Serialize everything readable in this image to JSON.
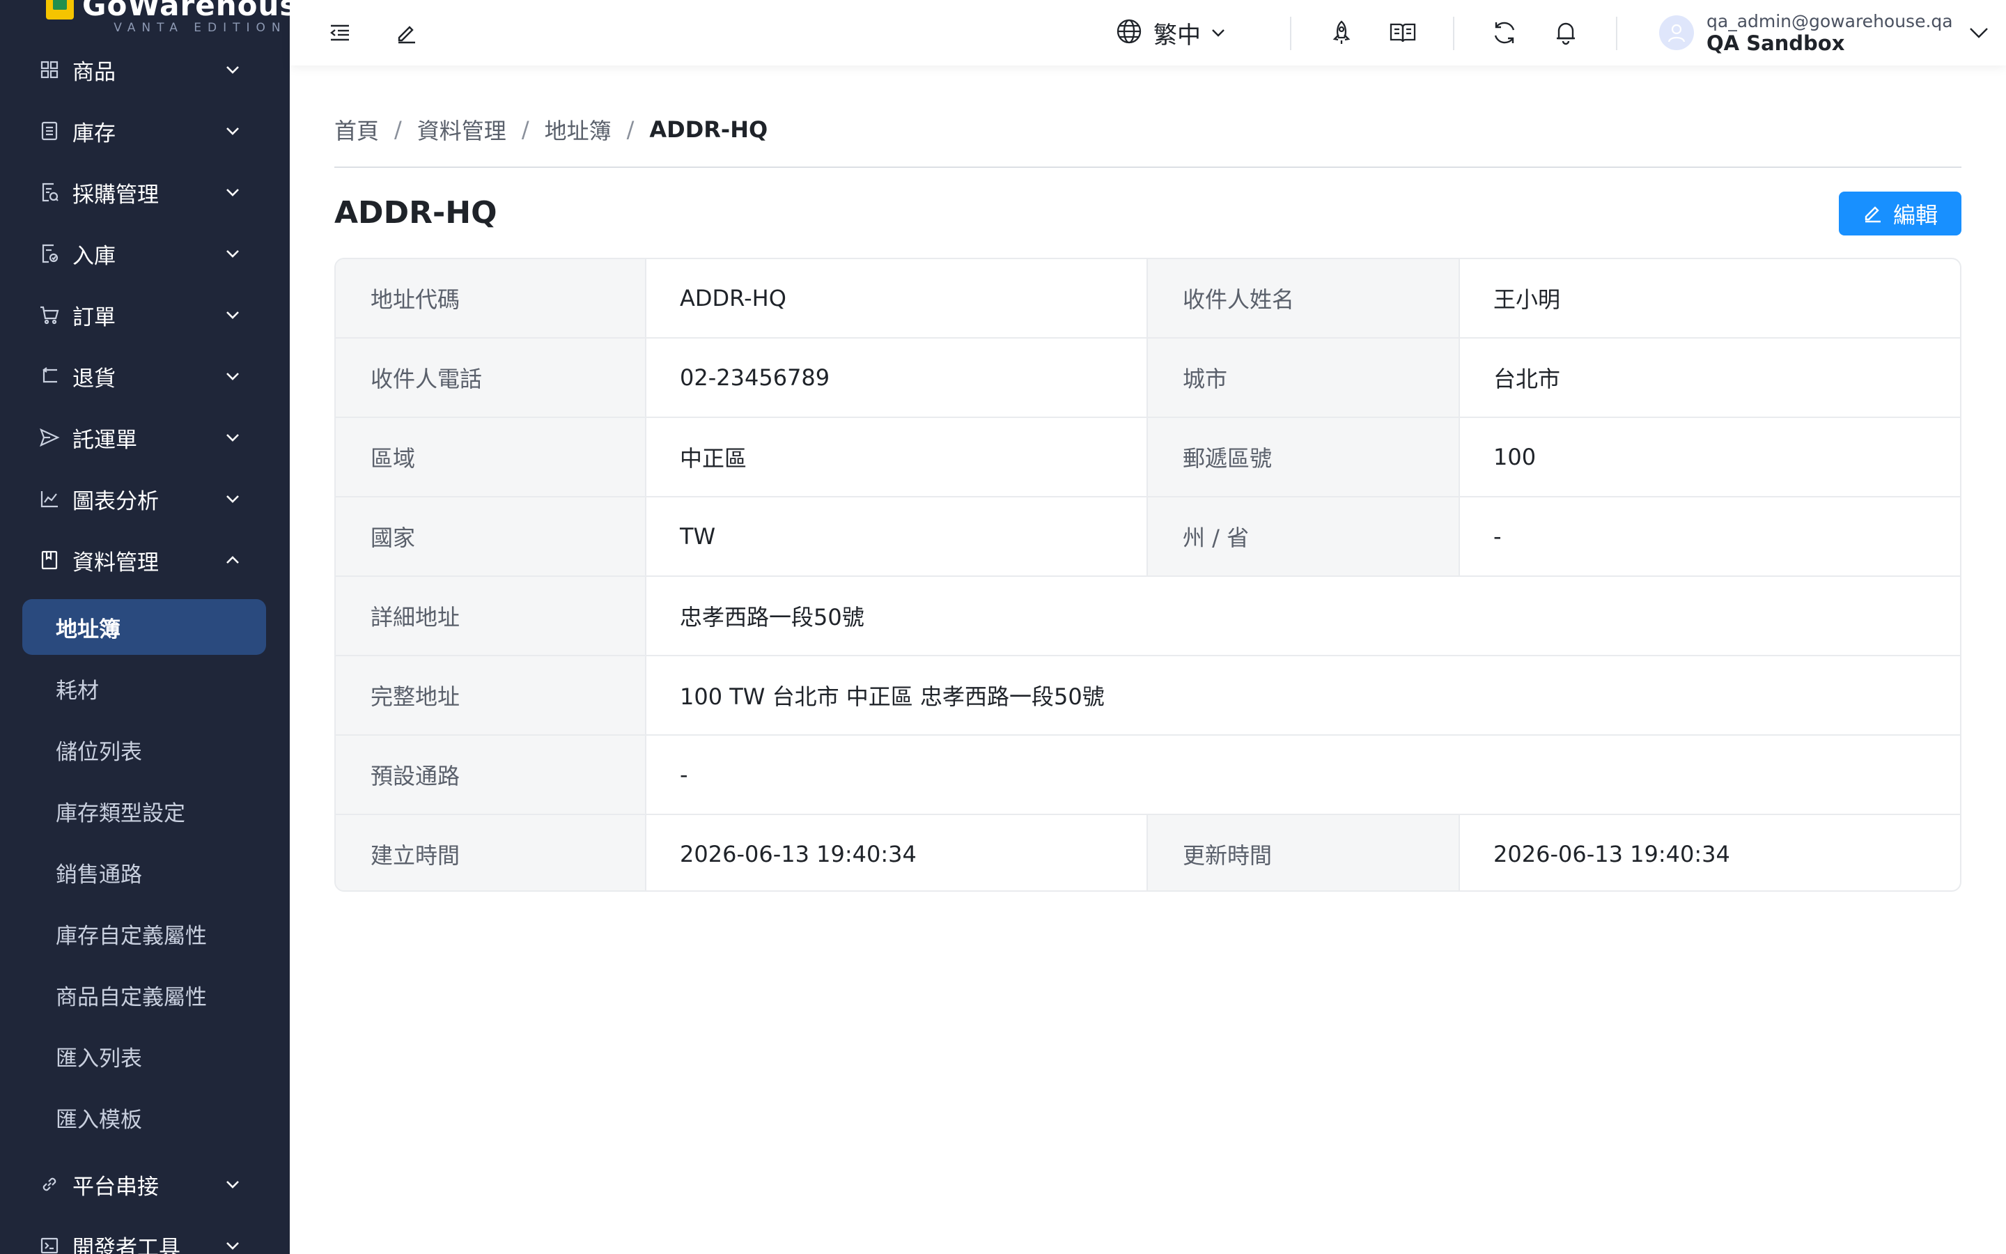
{
  "brand": {
    "name": "GoWarehouse",
    "edition": "VANTA EDITION"
  },
  "sidebar": {
    "menu": [
      {
        "label": "商品",
        "icon": "grid-icon",
        "expanded": false
      },
      {
        "label": "庫存",
        "icon": "inventory-icon",
        "expanded": false
      },
      {
        "label": "採購管理",
        "icon": "purchase-icon",
        "expanded": false
      },
      {
        "label": "入庫",
        "icon": "inbound-icon",
        "expanded": false
      },
      {
        "label": "訂單",
        "icon": "cart-icon",
        "expanded": false
      },
      {
        "label": "退貨",
        "icon": "return-icon",
        "expanded": false
      },
      {
        "label": "託運單",
        "icon": "send-icon",
        "expanded": false
      },
      {
        "label": "圖表分析",
        "icon": "line-chart-icon",
        "expanded": false
      },
      {
        "label": "資料管理",
        "icon": "book-icon",
        "expanded": true
      }
    ],
    "submenu": [
      {
        "label": "地址簿",
        "active": true
      },
      {
        "label": "耗材",
        "active": false
      },
      {
        "label": "儲位列表",
        "active": false
      },
      {
        "label": "庫存類型設定",
        "active": false
      },
      {
        "label": "銷售通路",
        "active": false
      },
      {
        "label": "庫存自定義屬性",
        "active": false
      },
      {
        "label": "商品自定義屬性",
        "active": false
      },
      {
        "label": "匯入列表",
        "active": false
      },
      {
        "label": "匯入模板",
        "active": false
      }
    ],
    "menu_bottom": [
      {
        "label": "平台串接",
        "icon": "link-icon",
        "expanded": false
      },
      {
        "label": "開發者工具",
        "icon": "terminal-icon",
        "expanded": false
      }
    ]
  },
  "header": {
    "language": "繁中",
    "user_email": "qa_admin@gowarehouse.qa",
    "user_org": "QA Sandbox"
  },
  "breadcrumb": {
    "items": [
      "首頁",
      "資料管理",
      "地址簿"
    ],
    "current": "ADDR-HQ",
    "separator": "/"
  },
  "page": {
    "title": "ADDR-HQ",
    "edit_label": "編輯"
  },
  "details": {
    "address_code": {
      "label": "地址代碼",
      "value": "ADDR-HQ"
    },
    "recipient_name": {
      "label": "收件人姓名",
      "value": "王小明"
    },
    "recipient_phone": {
      "label": "收件人電話",
      "value": "02-23456789"
    },
    "city": {
      "label": "城市",
      "value": "台北市"
    },
    "district": {
      "label": "區域",
      "value": "中正區"
    },
    "postal_code": {
      "label": "郵遞區號",
      "value": "100"
    },
    "country": {
      "label": "國家",
      "value": "TW"
    },
    "state": {
      "label": "州 / 省",
      "value": "-"
    },
    "detail_address": {
      "label": "詳細地址",
      "value": "忠孝西路一段50號"
    },
    "full_address": {
      "label": "完整地址",
      "value": "100 TW 台北市 中正區 忠孝西路一段50號"
    },
    "default_channel": {
      "label": "預設通路",
      "value": "-"
    },
    "created_at": {
      "label": "建立時間",
      "value": "2026-06-13 19:40:34"
    },
    "updated_at": {
      "label": "更新時間",
      "value": "2026-06-13 19:40:34"
    }
  },
  "colors": {
    "sidebar_bg": "#1f2639",
    "active_item_bg": "#2a4a7e",
    "primary": "#1890ff",
    "label_bg": "#f5f6f7"
  }
}
